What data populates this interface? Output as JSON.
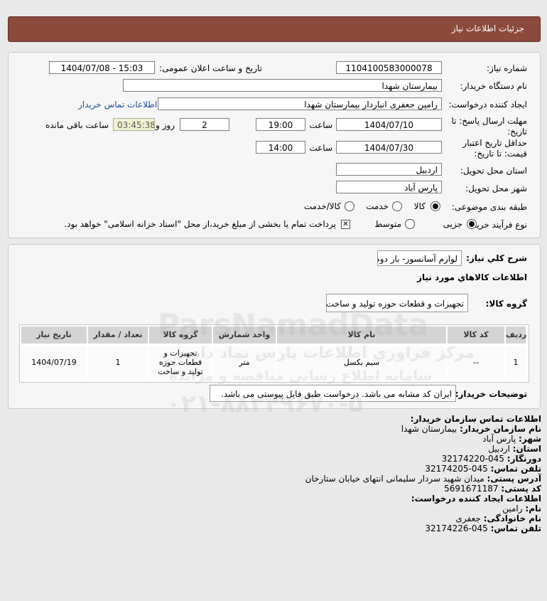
{
  "header": {
    "title": "جزئیات اطلاعات نیاز"
  },
  "form": {
    "need_number_label": "شماره نیاز:",
    "need_number": "1104100583000078",
    "announce_label": "تاریخ و ساعت اعلان عمومی:",
    "announce_value": "1404/07/08 - 15:03",
    "buyer_org_label": "نام دستگاه خریدار:",
    "buyer_org": "بیمارستان شهدا",
    "creator_label": "ایجاد کننده درخواست:",
    "creator": "رامین جعفری انباردار بیمارستان شهدا",
    "contact_link": "اطلاعات تماس خریدار",
    "deadline_label_1": "مهلت ارسال پاسخ: تا",
    "deadline_label_2": "تاریخ:",
    "deadline_date": "1404/07/10",
    "hour_label": "ساعت",
    "deadline_time": "19:00",
    "days_value": "2",
    "days_label": "روز و",
    "remaining_time": "03:45:38",
    "remaining_label": "ساعت باقی مانده",
    "validity_label_1": "حداقل تاریخ اعتبار",
    "validity_label_2": "قیمت: تا تاریخ:",
    "validity_date": "1404/07/30",
    "validity_hour_label": "ساعت",
    "validity_time": "14:00",
    "province_label": "استان محل تحویل:",
    "province": "اردبیل",
    "city_label": "شهر محل تحویل:",
    "city": "پارس آباد",
    "category_label": "طبقه بندی موضوعی:",
    "category_options": [
      "کالا",
      "خدمت",
      "کالا/خدمت"
    ],
    "category_selected": "کالا",
    "process_label": "نوع فرآیند خرید :",
    "process_options": [
      "جزیی",
      "متوسط"
    ],
    "process_selected": "جزیی",
    "payment_note": "پرداخت تمام یا بخشی از مبلغ خرید،از محل \"اسناد خزانه اسلامی\" خواهد بود."
  },
  "details": {
    "summary_label": "شرح کلي نياز:",
    "summary": "لوازم آسانسور- بار دوم",
    "goods_info_title": "اطلاعات کالاهاي مورد نياز",
    "goods_group_label": "گروه کالا:",
    "goods_group": "تجهیزات و قطعات حوزه تولید و ساخت",
    "table": {
      "headers": [
        "ردیف",
        "کد کالا",
        "نام کالا",
        "واحد شمارش",
        "گروه کالا",
        "تعداد / مقدار",
        "تاریخ نیاز"
      ],
      "rows": [
        [
          "1",
          "--",
          "سیم بکسل",
          "متر",
          "تجهیزات و قطعات حوزه تولید و ساخت",
          "1",
          "1404/07/19"
        ]
      ]
    },
    "buyer_notes_label": "توضیحات خریدار:",
    "buyer_notes": "ایران کد مشابه می باشد. درخواست طبق فایل پیوستی می باشد."
  },
  "contact": {
    "title": "اطلاعات تماس سازمان خریدار:",
    "org_label": "نام سازمان خریدار:",
    "org": "بیمارستان شهدا",
    "city_label": "شهر:",
    "city": "پارس آباد",
    "province_label": "استان:",
    "province": "اردبیل",
    "fax_label": "دورنگار:",
    "fax": "045-32174220",
    "phone_label": "تلفن تماس:",
    "phone": "045-32174205",
    "address_label": "آدرس پستی:",
    "address": "میدان شهید سردار سلیمانی انتهای خیابان ستارخان",
    "postal_label": "کد پستی:",
    "postal": "5691671187",
    "creator_title": "اطلاعات ایجاد کننده درخواست:",
    "name_label": "نام:",
    "name": "رامین",
    "family_label": "نام خانوادگی:",
    "family": "جعفری",
    "creator_phone_label": "تلفن تماس:",
    "creator_phone": "045-32174226"
  },
  "watermark": {
    "line1": "ParsNamadData",
    "line2": "مرکز فراوری اطلاعات پارس نماد داده",
    "line3": "سامانه اطلاع رسانی مناقصه و مزایده",
    "line4": "۰۲۱-۸۸۳۴۹۶۷۰-۵"
  }
}
